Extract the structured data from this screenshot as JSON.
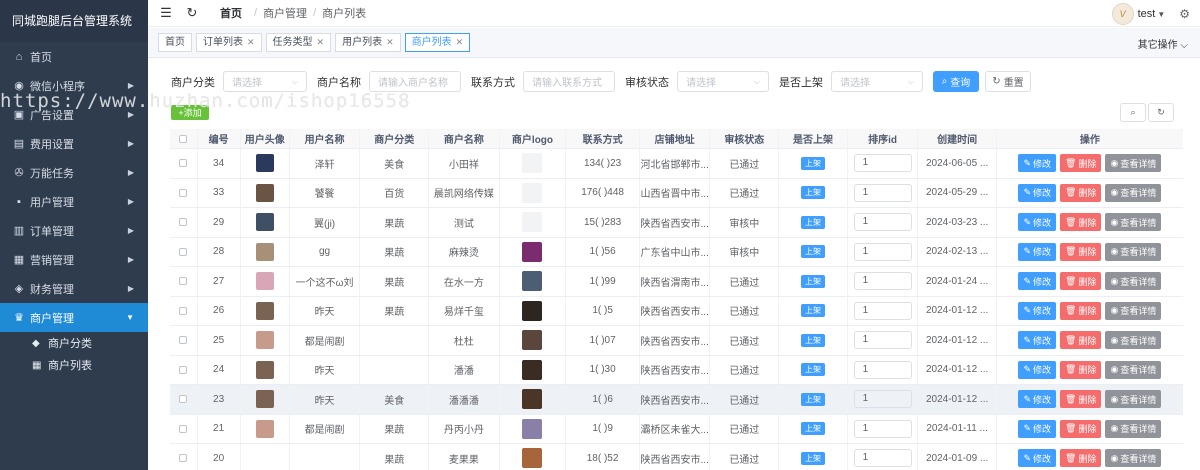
{
  "app": {
    "title": "同城跑腿后台管理系统"
  },
  "sidebar": {
    "items": [
      {
        "label": "首页",
        "icon": "home-icon",
        "has_arrow": false
      },
      {
        "label": "微信小程序",
        "icon": "wechat-icon",
        "has_arrow": true
      },
      {
        "label": "广告设置",
        "icon": "ad-icon",
        "has_arrow": true
      },
      {
        "label": "费用设置",
        "icon": "fee-icon",
        "has_arrow": true
      },
      {
        "label": "万能任务",
        "icon": "task-icon",
        "has_arrow": true
      },
      {
        "label": "用户管理",
        "icon": "user-icon",
        "has_arrow": true
      },
      {
        "label": "订单管理",
        "icon": "order-icon",
        "has_arrow": true
      },
      {
        "label": "营销管理",
        "icon": "marketing-icon",
        "has_arrow": true
      },
      {
        "label": "财务管理",
        "icon": "finance-icon",
        "has_arrow": true
      },
      {
        "label": "商户管理",
        "icon": "crown-icon",
        "has_arrow": true,
        "active": true
      }
    ],
    "sub_items": [
      {
        "label": "商户分类",
        "icon": "category-icon"
      },
      {
        "label": "商户列表",
        "icon": "list-icon"
      }
    ]
  },
  "topbar": {
    "breadcrumb": [
      "首页",
      "商户管理",
      "商户列表"
    ],
    "user": "test",
    "avatar_text": "V"
  },
  "tabs": [
    {
      "label": "首页",
      "closable": false
    },
    {
      "label": "订单列表",
      "closable": true
    },
    {
      "label": "任务类型",
      "closable": true
    },
    {
      "label": "用户列表",
      "closable": true
    },
    {
      "label": "商户列表",
      "closable": true,
      "active": true
    }
  ],
  "tabs_more": "其它操作",
  "filters": {
    "category_label": "商户分类",
    "category_placeholder": "请选择",
    "name_label": "商户名称",
    "name_placeholder": "请输入商户名称",
    "contact_label": "联系方式",
    "contact_placeholder": "请输入联系方式",
    "status_label": "审核状态",
    "status_placeholder": "请选择",
    "online_label": "是否上架",
    "online_placeholder": "请选择",
    "search_label": "查询",
    "reset_label": "重置"
  },
  "watermark": "https://www.huzhan.com/ishop16558",
  "add_label": "添加",
  "table": {
    "headers": [
      "编号",
      "用户头像",
      "用户名称",
      "商户分类",
      "商户名称",
      "商户logo",
      "联系方式",
      "店铺地址",
      "审核状态",
      "是否上架",
      "排序id",
      "创建时间",
      "操作"
    ],
    "op_labels": {
      "edit": "修改",
      "delete": "删除",
      "view": "查看详情"
    },
    "rows": [
      {
        "id": "34",
        "user": "泽轩",
        "category": "美食",
        "shop": "小田祥",
        "phone": "134(    )23",
        "address": "河北省邯郸市...",
        "status": "已通过",
        "online": "上架",
        "sort": "1",
        "created": "2024-06-05 ...",
        "avatar_color": "#2b3a5c",
        "logo": false
      },
      {
        "id": "33",
        "user": "饕餮",
        "category": "百货",
        "shop": "晨凯网络传媒",
        "phone": "176(    )448",
        "address": "山西省晋中市...",
        "status": "已通过",
        "online": "上架",
        "sort": "1",
        "created": "2024-05-29 ...",
        "avatar_color": "#6b5443",
        "logo": false
      },
      {
        "id": "29",
        "user": "翼(ji)",
        "category": "果蔬",
        "shop": "测试",
        "phone": "15(    )283",
        "address": "陕西省西安市...",
        "status": "审核中",
        "online": "上架",
        "sort": "1",
        "created": "2024-03-23 ...",
        "avatar_color": "#3f4f64",
        "logo": false
      },
      {
        "id": "28",
        "user": "gg",
        "category": "果蔬",
        "shop": "麻辣烫",
        "phone": "1(    )56",
        "address": "广东省中山市...",
        "status": "审核中",
        "online": "上架",
        "sort": "1",
        "created": "2024-02-13 ...",
        "avatar_color": "#a89078",
        "logo": true,
        "logo_color": "#7a2c6f"
      },
      {
        "id": "27",
        "user": "一个这不ω刘",
        "category": "果蔬",
        "shop": "在水一方",
        "phone": "1(    )99",
        "address": "陕西省渭南市...",
        "status": "已通过",
        "online": "上架",
        "sort": "1",
        "created": "2024-01-24 ...",
        "avatar_color": "#d9a6b7",
        "logo": true,
        "logo_color": "#4c5d74"
      },
      {
        "id": "26",
        "user": "昨天",
        "category": "果蔬",
        "shop": "易烊千玺",
        "phone": "1(    )5",
        "address": "陕西省西安市...",
        "status": "已通过",
        "online": "上架",
        "sort": "1",
        "created": "2024-01-12 ...",
        "avatar_color": "#7b6353",
        "logo": true,
        "logo_color": "#2d2520"
      },
      {
        "id": "25",
        "user": "都是闹剧",
        "category": "",
        "shop": "杜杜",
        "phone": "1(    )07",
        "address": "陕西省西安市...",
        "status": "已通过",
        "online": "上架",
        "sort": "1",
        "created": "2024-01-12 ...",
        "avatar_color": "#c79b8c",
        "logo": true,
        "logo_color": "#5a463c"
      },
      {
        "id": "24",
        "user": "昨天",
        "category": "",
        "shop": "潘潘",
        "phone": "1(    )30",
        "address": "陕西省西安市...",
        "status": "已通过",
        "online": "上架",
        "sort": "1",
        "created": "2024-01-12 ...",
        "avatar_color": "#7b6353",
        "logo": true,
        "logo_color": "#3b2c23"
      },
      {
        "id": "23",
        "user": "昨天",
        "category": "美食",
        "shop": "潘潘潘",
        "phone": "1(    )6",
        "address": "陕西省西安市...",
        "status": "已通过",
        "online": "上架",
        "sort": "1",
        "created": "2024-01-12 ...",
        "avatar_color": "#7b6353",
        "logo": true,
        "logo_color": "#4a3526",
        "highlight": true
      },
      {
        "id": "21",
        "user": "都是闹剧",
        "category": "果蔬",
        "shop": "丹丙小丹",
        "phone": "1(    )9",
        "address": "灞桥区未雀大...",
        "status": "已通过",
        "online": "上架",
        "sort": "1",
        "created": "2024-01-11 ...",
        "avatar_color": "#c79b8c",
        "logo": true,
        "logo_color": "#8a7fa6"
      },
      {
        "id": "20",
        "user": "",
        "category": "果蔬",
        "shop": "麦果果",
        "phone": "18(    )52",
        "address": "陕西省西安市...",
        "status": "已通过",
        "online": "上架",
        "sort": "1",
        "created": "2024-01-09 ...",
        "avatar_color": "",
        "logo": true,
        "logo_color": "#a8643a"
      }
    ]
  }
}
